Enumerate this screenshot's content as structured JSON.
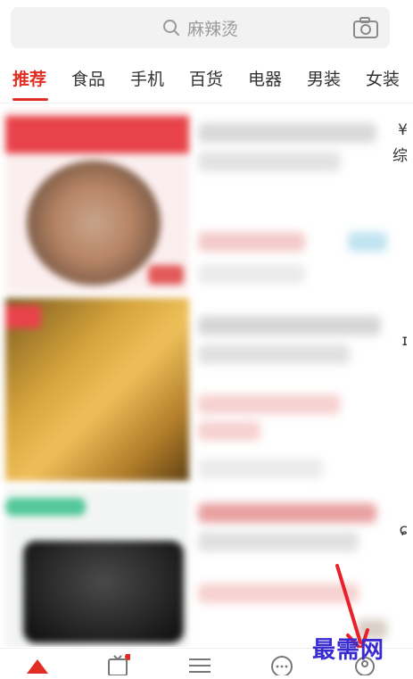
{
  "search": {
    "placeholder": "麻辣烫",
    "icon": "search-icon",
    "camera_icon": "camera-icon"
  },
  "tabs": [
    "推荐",
    "食品",
    "手机",
    "百货",
    "电器",
    "男装",
    "女装"
  ],
  "feed": {
    "row1_edge": "¥",
    "row1_edge2": "综",
    "row2_edge": "ɪ",
    "row3_edge": "ɕ"
  },
  "watermark": "最需网",
  "colors": {
    "accent": "#e02e24",
    "watermark": "#3a2bd1"
  },
  "bottom_nav": [
    {
      "icon": "home-icon"
    },
    {
      "icon": "video-icon"
    },
    {
      "icon": "category-icon"
    },
    {
      "icon": "chat-icon"
    },
    {
      "icon": "profile-icon"
    }
  ]
}
